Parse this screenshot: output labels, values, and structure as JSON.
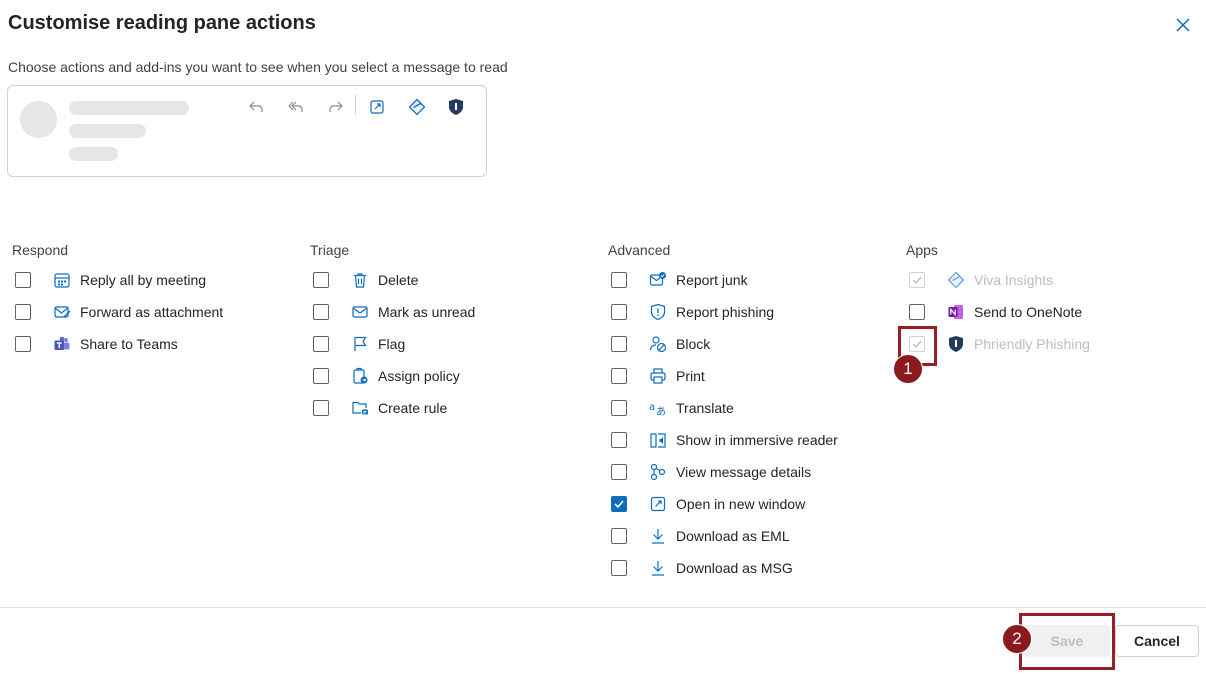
{
  "dialog": {
    "title": "Customise reading pane actions",
    "subtitle": "Choose actions and add-ins you want to see when you select a message to read",
    "close_icon": "close-icon"
  },
  "preview": {
    "toolbar_icons": [
      "reply-icon",
      "reply-all-icon",
      "forward-icon",
      "open-in-new-window-icon",
      "viva-insights-icon",
      "phriendly-phishing-shield-icon"
    ]
  },
  "columns": {
    "respond": {
      "heading": "Respond",
      "items": [
        {
          "label": "Reply all by meeting",
          "icon": "calendar-icon",
          "checked": false
        },
        {
          "label": "Forward as attachment",
          "icon": "mail-forward-attachment-icon",
          "checked": false
        },
        {
          "label": "Share to Teams",
          "icon": "teams-icon",
          "checked": false
        }
      ]
    },
    "triage": {
      "heading": "Triage",
      "items": [
        {
          "label": "Delete",
          "icon": "trash-icon",
          "checked": false
        },
        {
          "label": "Mark as unread",
          "icon": "envelope-icon",
          "checked": false
        },
        {
          "label": "Flag",
          "icon": "flag-icon",
          "checked": false
        },
        {
          "label": "Assign policy",
          "icon": "assign-policy-icon",
          "checked": false
        },
        {
          "label": "Create rule",
          "icon": "folder-rule-icon",
          "checked": false
        }
      ]
    },
    "advanced": {
      "heading": "Advanced",
      "items": [
        {
          "label": "Report junk",
          "icon": "report-junk-icon",
          "checked": false
        },
        {
          "label": "Report phishing",
          "icon": "shield-alert-icon",
          "checked": false
        },
        {
          "label": "Block",
          "icon": "block-person-icon",
          "checked": false
        },
        {
          "label": "Print",
          "icon": "printer-icon",
          "checked": false
        },
        {
          "label": "Translate",
          "icon": "translate-icon",
          "checked": false
        },
        {
          "label": "Show in immersive reader",
          "icon": "immersive-reader-icon",
          "checked": false
        },
        {
          "label": "View message details",
          "icon": "message-details-icon",
          "checked": false
        },
        {
          "label": "Open in new window",
          "icon": "open-in-new-window-icon",
          "checked": true
        },
        {
          "label": "Download as EML",
          "icon": "download-icon",
          "checked": false
        },
        {
          "label": "Download as MSG",
          "icon": "download-icon",
          "checked": false
        }
      ]
    },
    "apps": {
      "heading": "Apps",
      "items": [
        {
          "label": "Viva Insights",
          "icon": "viva-insights-icon",
          "checked": true,
          "disabled": true
        },
        {
          "label": "Send to OneNote",
          "icon": "onenote-icon",
          "checked": false,
          "disabled": false
        },
        {
          "label": "Phriendly Phishing",
          "icon": "phriendly-phishing-shield-icon",
          "checked": true,
          "disabled": true
        }
      ]
    }
  },
  "footer": {
    "save_label": "Save",
    "cancel_label": "Cancel"
  },
  "annotations": [
    {
      "number": "1"
    },
    {
      "number": "2"
    }
  ],
  "colors": {
    "accent": "#0f6cbd",
    "annotation": "#9b1c24",
    "onenote": "#7719aa",
    "teams": "#5b5fc7",
    "shield_dark": "#243a5e"
  }
}
